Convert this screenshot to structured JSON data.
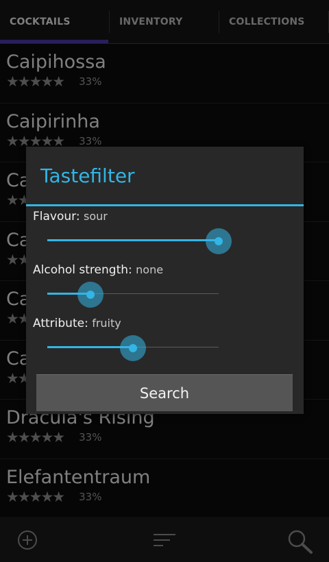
{
  "tabs": [
    {
      "label": "COCKTAILS",
      "active": true
    },
    {
      "label": "INVENTORY",
      "active": false
    },
    {
      "label": "COLLECTIONS",
      "active": false
    }
  ],
  "cocktails": [
    {
      "name": "Caipihossa",
      "stars": "★★★★★",
      "percent": "33%"
    },
    {
      "name": "Caipirinha",
      "stars": "★★★★★",
      "percent": "33%"
    },
    {
      "name": "Ca",
      "stars": "★★★★★",
      "percent": ""
    },
    {
      "name": "Ca",
      "stars": "★★★★★",
      "percent": ""
    },
    {
      "name": "Ca",
      "stars": "★★★★★",
      "percent": ""
    },
    {
      "name": "Ca",
      "stars": "★★★★★",
      "percent": ""
    },
    {
      "name": "Dracula's Rising",
      "stars": "★★★★★",
      "percent": "33%"
    },
    {
      "name": "Elefantentraum",
      "stars": "★★★★★",
      "percent": "33%"
    }
  ],
  "dialog": {
    "title": "Tastefilter",
    "filters": [
      {
        "label": "Flavour:",
        "value": "sour",
        "level": 1.0
      },
      {
        "label": "Alcohol strength:",
        "value": "none",
        "level": 0.25
      },
      {
        "label": "Attribute:",
        "value": "fruity",
        "level": 0.5
      }
    ],
    "search_label": "Search"
  },
  "bottom_bar": {
    "icons": [
      "add-icon",
      "sort-icon",
      "search-icon"
    ]
  },
  "colors": {
    "accent": "#33b5e5",
    "tab_indicator": "#4a3aa8"
  }
}
